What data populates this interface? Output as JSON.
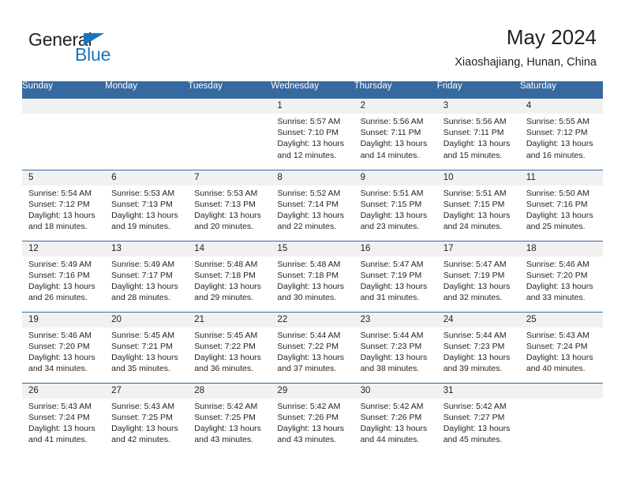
{
  "logo": {
    "word1": "General",
    "word2": "Blue",
    "triangle_color": "#1b75bb"
  },
  "header": {
    "title": "May 2024",
    "subtitle": "Xiaoshajiang, Hunan, China",
    "header_bg": "#36699f",
    "daynum_bg": "#f1f1f1"
  },
  "weekdays": [
    "Sunday",
    "Monday",
    "Tuesday",
    "Wednesday",
    "Thursday",
    "Friday",
    "Saturday"
  ],
  "labels": {
    "sunrise": "Sunrise:",
    "sunset": "Sunset:",
    "daylight": "Daylight:"
  },
  "weeks": [
    [
      {
        "day": "",
        "blank": true
      },
      {
        "day": "",
        "blank": true
      },
      {
        "day": "",
        "blank": true
      },
      {
        "day": "1",
        "sunrise": "Sunrise: 5:57 AM",
        "sunset": "Sunset: 7:10 PM",
        "daylight1": "Daylight: 13 hours",
        "daylight2": "and 12 minutes."
      },
      {
        "day": "2",
        "sunrise": "Sunrise: 5:56 AM",
        "sunset": "Sunset: 7:11 PM",
        "daylight1": "Daylight: 13 hours",
        "daylight2": "and 14 minutes."
      },
      {
        "day": "3",
        "sunrise": "Sunrise: 5:56 AM",
        "sunset": "Sunset: 7:11 PM",
        "daylight1": "Daylight: 13 hours",
        "daylight2": "and 15 minutes."
      },
      {
        "day": "4",
        "sunrise": "Sunrise: 5:55 AM",
        "sunset": "Sunset: 7:12 PM",
        "daylight1": "Daylight: 13 hours",
        "daylight2": "and 16 minutes."
      }
    ],
    [
      {
        "day": "5",
        "sunrise": "Sunrise: 5:54 AM",
        "sunset": "Sunset: 7:12 PM",
        "daylight1": "Daylight: 13 hours",
        "daylight2": "and 18 minutes."
      },
      {
        "day": "6",
        "sunrise": "Sunrise: 5:53 AM",
        "sunset": "Sunset: 7:13 PM",
        "daylight1": "Daylight: 13 hours",
        "daylight2": "and 19 minutes."
      },
      {
        "day": "7",
        "sunrise": "Sunrise: 5:53 AM",
        "sunset": "Sunset: 7:13 PM",
        "daylight1": "Daylight: 13 hours",
        "daylight2": "and 20 minutes."
      },
      {
        "day": "8",
        "sunrise": "Sunrise: 5:52 AM",
        "sunset": "Sunset: 7:14 PM",
        "daylight1": "Daylight: 13 hours",
        "daylight2": "and 22 minutes."
      },
      {
        "day": "9",
        "sunrise": "Sunrise: 5:51 AM",
        "sunset": "Sunset: 7:15 PM",
        "daylight1": "Daylight: 13 hours",
        "daylight2": "and 23 minutes."
      },
      {
        "day": "10",
        "sunrise": "Sunrise: 5:51 AM",
        "sunset": "Sunset: 7:15 PM",
        "daylight1": "Daylight: 13 hours",
        "daylight2": "and 24 minutes."
      },
      {
        "day": "11",
        "sunrise": "Sunrise: 5:50 AM",
        "sunset": "Sunset: 7:16 PM",
        "daylight1": "Daylight: 13 hours",
        "daylight2": "and 25 minutes."
      }
    ],
    [
      {
        "day": "12",
        "sunrise": "Sunrise: 5:49 AM",
        "sunset": "Sunset: 7:16 PM",
        "daylight1": "Daylight: 13 hours",
        "daylight2": "and 26 minutes."
      },
      {
        "day": "13",
        "sunrise": "Sunrise: 5:49 AM",
        "sunset": "Sunset: 7:17 PM",
        "daylight1": "Daylight: 13 hours",
        "daylight2": "and 28 minutes."
      },
      {
        "day": "14",
        "sunrise": "Sunrise: 5:48 AM",
        "sunset": "Sunset: 7:18 PM",
        "daylight1": "Daylight: 13 hours",
        "daylight2": "and 29 minutes."
      },
      {
        "day": "15",
        "sunrise": "Sunrise: 5:48 AM",
        "sunset": "Sunset: 7:18 PM",
        "daylight1": "Daylight: 13 hours",
        "daylight2": "and 30 minutes."
      },
      {
        "day": "16",
        "sunrise": "Sunrise: 5:47 AM",
        "sunset": "Sunset: 7:19 PM",
        "daylight1": "Daylight: 13 hours",
        "daylight2": "and 31 minutes."
      },
      {
        "day": "17",
        "sunrise": "Sunrise: 5:47 AM",
        "sunset": "Sunset: 7:19 PM",
        "daylight1": "Daylight: 13 hours",
        "daylight2": "and 32 minutes."
      },
      {
        "day": "18",
        "sunrise": "Sunrise: 5:46 AM",
        "sunset": "Sunset: 7:20 PM",
        "daylight1": "Daylight: 13 hours",
        "daylight2": "and 33 minutes."
      }
    ],
    [
      {
        "day": "19",
        "sunrise": "Sunrise: 5:46 AM",
        "sunset": "Sunset: 7:20 PM",
        "daylight1": "Daylight: 13 hours",
        "daylight2": "and 34 minutes."
      },
      {
        "day": "20",
        "sunrise": "Sunrise: 5:45 AM",
        "sunset": "Sunset: 7:21 PM",
        "daylight1": "Daylight: 13 hours",
        "daylight2": "and 35 minutes."
      },
      {
        "day": "21",
        "sunrise": "Sunrise: 5:45 AM",
        "sunset": "Sunset: 7:22 PM",
        "daylight1": "Daylight: 13 hours",
        "daylight2": "and 36 minutes."
      },
      {
        "day": "22",
        "sunrise": "Sunrise: 5:44 AM",
        "sunset": "Sunset: 7:22 PM",
        "daylight1": "Daylight: 13 hours",
        "daylight2": "and 37 minutes."
      },
      {
        "day": "23",
        "sunrise": "Sunrise: 5:44 AM",
        "sunset": "Sunset: 7:23 PM",
        "daylight1": "Daylight: 13 hours",
        "daylight2": "and 38 minutes."
      },
      {
        "day": "24",
        "sunrise": "Sunrise: 5:44 AM",
        "sunset": "Sunset: 7:23 PM",
        "daylight1": "Daylight: 13 hours",
        "daylight2": "and 39 minutes."
      },
      {
        "day": "25",
        "sunrise": "Sunrise: 5:43 AM",
        "sunset": "Sunset: 7:24 PM",
        "daylight1": "Daylight: 13 hours",
        "daylight2": "and 40 minutes."
      }
    ],
    [
      {
        "day": "26",
        "sunrise": "Sunrise: 5:43 AM",
        "sunset": "Sunset: 7:24 PM",
        "daylight1": "Daylight: 13 hours",
        "daylight2": "and 41 minutes."
      },
      {
        "day": "27",
        "sunrise": "Sunrise: 5:43 AM",
        "sunset": "Sunset: 7:25 PM",
        "daylight1": "Daylight: 13 hours",
        "daylight2": "and 42 minutes."
      },
      {
        "day": "28",
        "sunrise": "Sunrise: 5:42 AM",
        "sunset": "Sunset: 7:25 PM",
        "daylight1": "Daylight: 13 hours",
        "daylight2": "and 43 minutes."
      },
      {
        "day": "29",
        "sunrise": "Sunrise: 5:42 AM",
        "sunset": "Sunset: 7:26 PM",
        "daylight1": "Daylight: 13 hours",
        "daylight2": "and 43 minutes."
      },
      {
        "day": "30",
        "sunrise": "Sunrise: 5:42 AM",
        "sunset": "Sunset: 7:26 PM",
        "daylight1": "Daylight: 13 hours",
        "daylight2": "and 44 minutes."
      },
      {
        "day": "31",
        "sunrise": "Sunrise: 5:42 AM",
        "sunset": "Sunset: 7:27 PM",
        "daylight1": "Daylight: 13 hours",
        "daylight2": "and 45 minutes."
      },
      {
        "day": "",
        "blank": true
      }
    ]
  ]
}
